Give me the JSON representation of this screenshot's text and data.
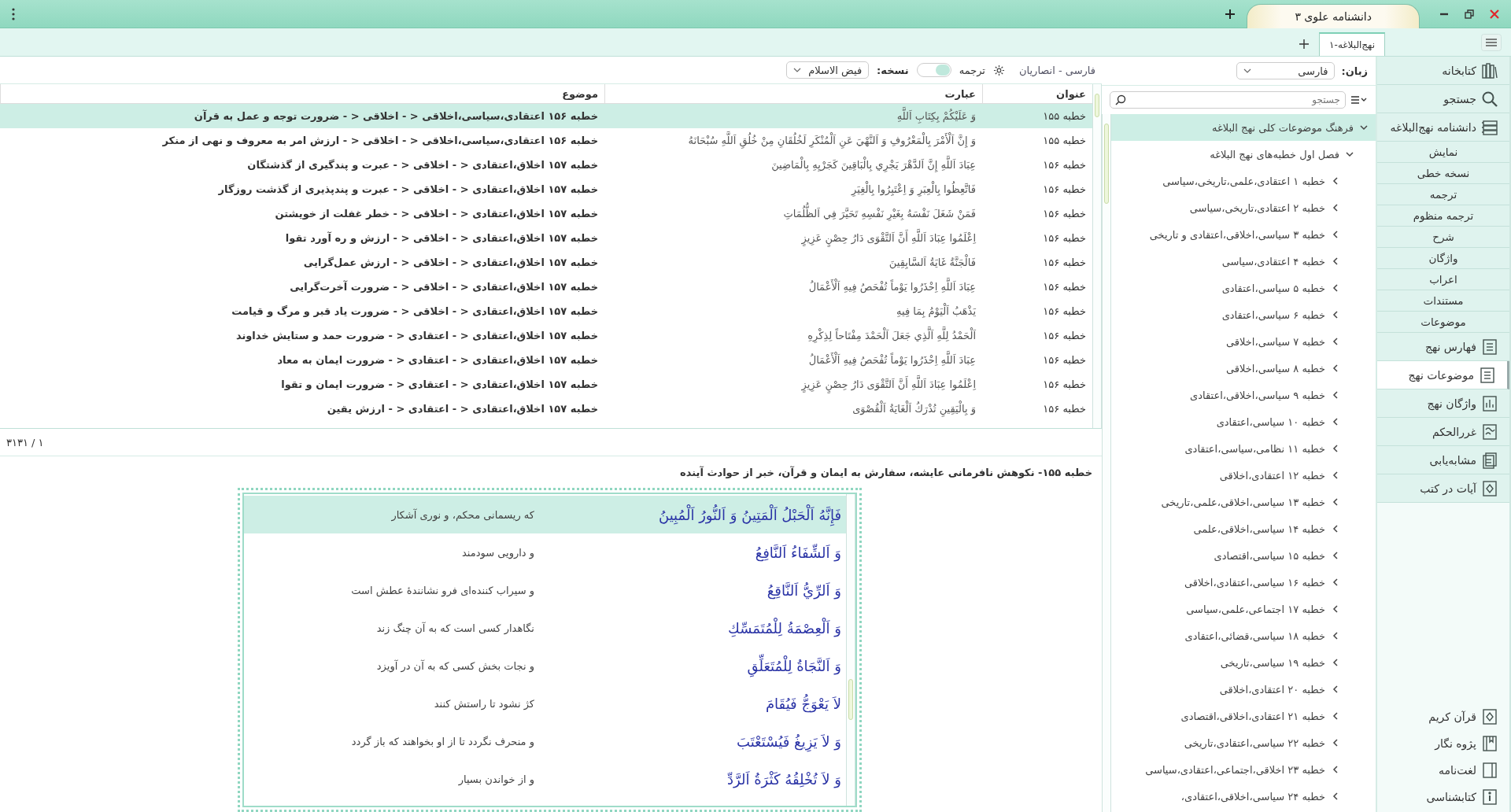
{
  "window": {
    "app_tab": "دانشنامه علوی ۳"
  },
  "doc_tabs": [
    {
      "label": "نهج‌البلاغه-۱",
      "selected": true
    }
  ],
  "sidebar": {
    "items": [
      {
        "label": "کتابخانه",
        "kind": "books",
        "selected": false
      },
      {
        "label": "جستجو",
        "kind": "search",
        "selected": false
      },
      {
        "label": "دانشنامه نهج‌البلاغه",
        "kind": "stack",
        "selected": false
      },
      {
        "label": "نمایش",
        "kind": "sub",
        "selected": false
      },
      {
        "label": "نسخه خطی",
        "kind": "sub",
        "selected": false
      },
      {
        "label": "ترجمه",
        "kind": "sub",
        "selected": false
      },
      {
        "label": "ترجمه منظوم",
        "kind": "sub",
        "selected": false
      },
      {
        "label": "شرح",
        "kind": "sub",
        "selected": false
      },
      {
        "label": "واژگان",
        "kind": "sub",
        "selected": false
      },
      {
        "label": "اعراب",
        "kind": "sub",
        "selected": false
      },
      {
        "label": "مستندات",
        "kind": "sub",
        "selected": false
      },
      {
        "label": "موضوعات",
        "kind": "sub",
        "selected": false
      },
      {
        "label": "فهارس نهج",
        "kind": "list",
        "selected": false
      },
      {
        "label": "موضوعات نهج",
        "kind": "list",
        "selected": true
      },
      {
        "label": "واژگان نهج",
        "kind": "chart",
        "selected": false
      },
      {
        "label": "غررالحکم",
        "kind": "ghurar",
        "selected": false
      },
      {
        "label": "مشابه‌یابی",
        "kind": "pages",
        "selected": false
      },
      {
        "label": "آیات در کتب",
        "kind": "verses",
        "selected": false
      }
    ],
    "bottom_items": [
      {
        "label": "قرآن کریم",
        "kind": "quran",
        "selected": false
      },
      {
        "label": "پژوه نگار",
        "kind": "research",
        "selected": false
      },
      {
        "label": "لغت‌نامه",
        "kind": "dictionary",
        "selected": false
      },
      {
        "label": "کتابشناسی",
        "kind": "info",
        "selected": false
      }
    ]
  },
  "language": {
    "label": "زبان:",
    "value": "فارسی"
  },
  "tree": {
    "search_placeholder": "جستجو",
    "root": {
      "label": "فرهنگ موضوعات کلی نهج البلاغه",
      "expanded": true,
      "selected": true,
      "children": [
        {
          "label": "فصل اول خطبه‌های نهج البلاغه",
          "expanded": true,
          "selected": false,
          "children": [
            {
              "label": "خطبه ۱ اعتقادی،علمی،تاریخی،سیاسی",
              "expanded": false,
              "selected": false
            },
            {
              "label": "خطبه ۲ اعتقادی،تاریخی،سیاسی",
              "expanded": false,
              "selected": false
            },
            {
              "label": "خطبه ۳ سیاسی،اخلاقی،اعتقادی و تاریخی",
              "expanded": false,
              "selected": false
            },
            {
              "label": "خطبه ۴ اعتقادی،سیاسی",
              "expanded": false,
              "selected": false
            },
            {
              "label": "خطبه ۵ سیاسی،اعتقادی",
              "expanded": false,
              "selected": false
            },
            {
              "label": "خطبه ۶ سیاسی،اعتقادی",
              "expanded": false,
              "selected": false
            },
            {
              "label": "خطبه ۷ سیاسی،اخلاقی",
              "expanded": false,
              "selected": false
            },
            {
              "label": "خطبه ۸ سیاسی،اخلاقی",
              "expanded": false,
              "selected": false
            },
            {
              "label": "خطبه ۹ سیاسی،اخلاقی،اعتقادی",
              "expanded": false,
              "selected": false
            },
            {
              "label": "خطبه ۱۰ سیاسی،اعتقادی",
              "expanded": false,
              "selected": false
            },
            {
              "label": "خطبه ۱۱ نظامی،سیاسی،اعتقادی",
              "expanded": false,
              "selected": false
            },
            {
              "label": "خطبه ۱۲ اعتقادی،اخلاقی",
              "expanded": false,
              "selected": false
            },
            {
              "label": "خطبه ۱۳ سیاسی،اخلاقی،علمی،تاریخی",
              "expanded": false,
              "selected": false
            },
            {
              "label": "خطبه ۱۴ سیاسی،اخلاقی،علمی",
              "expanded": false,
              "selected": false
            },
            {
              "label": "خطبه ۱۵ سیاسی،اقتصادی",
              "expanded": false,
              "selected": false
            },
            {
              "label": "خطبه ۱۶ سیاسی،اعتقادی،اخلاقی",
              "expanded": false,
              "selected": false
            },
            {
              "label": "خطبه ۱۷ اجتماعی،علمی،سیاسی",
              "expanded": false,
              "selected": false
            },
            {
              "label": "خطبه ۱۸ سیاسی،قضائی،اعتقادی",
              "expanded": false,
              "selected": false
            },
            {
              "label": "خطبه ۱۹ سیاسی،تاریخی",
              "expanded": false,
              "selected": false
            },
            {
              "label": "خطبه ۲۰ اعتقادی،اخلاقی",
              "expanded": false,
              "selected": false
            },
            {
              "label": "خطبه ۲۱ اعتقادی،اخلاقی،اقتصادی",
              "expanded": false,
              "selected": false
            },
            {
              "label": "خطبه ۲۲ سیاسی،اعتقادی،تاریخی",
              "expanded": false,
              "selected": false
            },
            {
              "label": "خطبه ۲۳ اخلاقی،اجتماعی،اعتقادی،سیاسی",
              "expanded": false,
              "selected": false
            },
            {
              "label": "خطبه ۲۴ سیاسی،اخلاقی،اعتقادی،",
              "expanded": false,
              "selected": false
            }
          ]
        }
      ]
    }
  },
  "toolbar": {
    "translator": "فارسی - انصاریان",
    "translation_label": "ترجمه",
    "translation_on": true,
    "edition_label": "نسخه:",
    "edition": "فیض الاسلام"
  },
  "table": {
    "columns": [
      "عنوان",
      "عبارت",
      "موضوع"
    ],
    "rows": [
      {
        "cells": [
          "خطبه ۱۵۵",
          "وَ عَلَيْكُمْ بِكِتَابِ اَللَّهِ",
          "خطبه ۱۵۶ اعتقادی،سیاسی،اخلاقی < - اخلاقی < - ضرورت توجه و عمل به قرآن"
        ],
        "selected": true
      },
      {
        "cells": [
          "خطبه ۱۵۵",
          "وَ إِنَّ اَلْأَمْرَ بِالْمَعْرُوفِ وَ اَلنَّهْيَ عَنِ اَلْمُنْكَرِ لَخُلُقَانِ مِنْ خُلُقِ اَللَّهِ سُبْحَانَهُ",
          "خطبه ۱۵۶ اعتقادی،سیاسی،اخلاقی < - اخلاقی < - ارزش امر به معروف و نهی از منکر"
        ],
        "selected": false
      },
      {
        "cells": [
          "خطبه ۱۵۶",
          "عِبَادَ اَللَّهِ إِنَّ اَلدَّهْرَ يَجْرِي بِالْبَاقِينَ كَجَرْيِهِ بِالْمَاضِينَ",
          "خطبه ۱۵۷ اخلاق،اعتقادی < - اخلاقی < - عبرت و پندگیری از گذشتگان"
        ],
        "selected": false
      },
      {
        "cells": [
          "خطبه ۱۵۶",
          "فَاتَّعِظُوا بِالْعِبَرِ وَ اِعْتَبِرُوا بِالْغِيَرِ",
          "خطبه ۱۵۷ اخلاق،اعتقادی < - اخلاقی < - عبرت و پندپذیری از گذشت روزگار"
        ],
        "selected": false
      },
      {
        "cells": [
          "خطبه ۱۵۶",
          "فَمَنْ شَغَلَ نَفْسَهُ بِغَيْرِ نَفْسِهِ تَحَيَّرَ فِي اَلظُّلُمَاتِ",
          "خطبه ۱۵۷ اخلاق،اعتقادی < - اخلاقی < - خطر غفلت از خویشتن"
        ],
        "selected": false
      },
      {
        "cells": [
          "خطبه ۱۵۶",
          "اِعْلَمُوا عِبَادَ اَللَّهِ أَنَّ اَلتَّقْوَى دَارُ حِصْنٍ عَزِيزٍ",
          "خطبه ۱۵۷ اخلاق،اعتقادی < - اخلاقی < - ارزش و ره آورد تقوا"
        ],
        "selected": false
      },
      {
        "cells": [
          "خطبه ۱۵۶",
          "فَالْجَنَّةُ غَايَةُ اَلسَّابِقِينَ",
          "خطبه ۱۵۷ اخلاق،اعتقادی < - اخلاقی < - ارزش عمل‌گرایی"
        ],
        "selected": false
      },
      {
        "cells": [
          "خطبه ۱۵۶",
          "عِبَادَ اَللَّهِ اِحْذَرُوا يَوْماً تُفْحَصُ فِيهِ اَلْأَعْمَالُ",
          "خطبه ۱۵۷ اخلاق،اعتقادی < - اخلاقی < - ضرورت آخرت‌گرایی"
        ],
        "selected": false
      },
      {
        "cells": [
          "خطبه ۱۵۶",
          "يَذْهَبُ اَلْيَوْمُ بِمَا فِيهِ",
          "خطبه ۱۵۷ اخلاق،اعتقادی < - اخلاقی < - ضرورت یاد قبر و مرگ و قیامت"
        ],
        "selected": false
      },
      {
        "cells": [
          "خطبه ۱۵۶",
          "اَلْحَمْدُ لِلَّهِ اَلَّذِي جَعَلَ اَلْحَمْدَ مِفْتَاحاً لِذِكْرِهِ",
          "خطبه ۱۵۷ اخلاق،اعتقادی < - اعتقادی < - ضرورت حمد و ستایش خداوند"
        ],
        "selected": false
      },
      {
        "cells": [
          "خطبه ۱۵۶",
          "عِبَادَ اَللَّهِ اِحْذَرُوا يَوْماً تُفْحَصُ فِيهِ اَلْأَعْمَالُ",
          "خطبه ۱۵۷ اخلاق،اعتقادی < - اعتقادی < - ضرورت ایمان به معاد"
        ],
        "selected": false
      },
      {
        "cells": [
          "خطبه ۱۵۶",
          "اِعْلَمُوا عِبَادَ اَللَّهِ أَنَّ اَلتَّقْوَى دَارُ حِصْنٍ عَزِيزٍ",
          "خطبه ۱۵۷ اخلاق،اعتقادی < - اعتقادی < - ضرورت ایمان و تقوا"
        ],
        "selected": false
      },
      {
        "cells": [
          "خطبه ۱۵۶",
          "وَ بِالْيَقِينِ تُدْرَكُ اَلْغَايَةُ اَلْقُصْوَى",
          "خطبه ۱۵۷ اخلاق،اعتقادی < - اعتقادی < - ارزش یقین"
        ],
        "selected": false
      }
    ]
  },
  "pager": "۱ / ۳۱۳۱",
  "reader": {
    "title": "خطبه ۱۵۵- نکوهش نافرمانی عایشه، سفارش به ایمان و قرآن، خبر از حوادث آینده",
    "rows": [
      {
        "arabic": "فَإِنَّهُ اَلْحَبْلُ اَلْمَتِينُ وَ اَلنُّورُ اَلْمُبِينُ",
        "translation": "که ریسمانی محکم، و نوری آشکار",
        "selected": true
      },
      {
        "arabic": "وَ اَلشِّفَاءُ اَلنَّافِعُ",
        "translation": "و دارویی سودمند",
        "selected": false
      },
      {
        "arabic": "وَ اَلرِّيُّ اَلنَّاقِعُ",
        "translation": "و سیراب کننده‌ای فرو نشانندهٔ عطش است",
        "selected": false
      },
      {
        "arabic": "وَ اَلْعِصْمَةُ لِلْمُتَمَسِّكِ",
        "translation": "نگاهدار کسی است که به آن چنگ زند",
        "selected": false
      },
      {
        "arabic": "وَ اَلنَّجَاةُ لِلْمُتَعَلِّقِ",
        "translation": "و نجات بخش کسی که به آن در آویزد",
        "selected": false
      },
      {
        "arabic": "لاَ يَعْوَجُّ فَيُقَامَ",
        "translation": "کژ نشود تا راستش کنند",
        "selected": false
      },
      {
        "arabic": "وَ لاَ يَزِيغُ فَيُسْتَعْتَبَ",
        "translation": "و منحرف نگردد تا از او بخواهند که باز گردد",
        "selected": false
      },
      {
        "arabic": "وَ لاَ تُخْلِقُهُ كَثْرَةُ اَلرَّدِّ",
        "translation": "و از خواندن بسیار",
        "selected": false
      }
    ]
  }
}
